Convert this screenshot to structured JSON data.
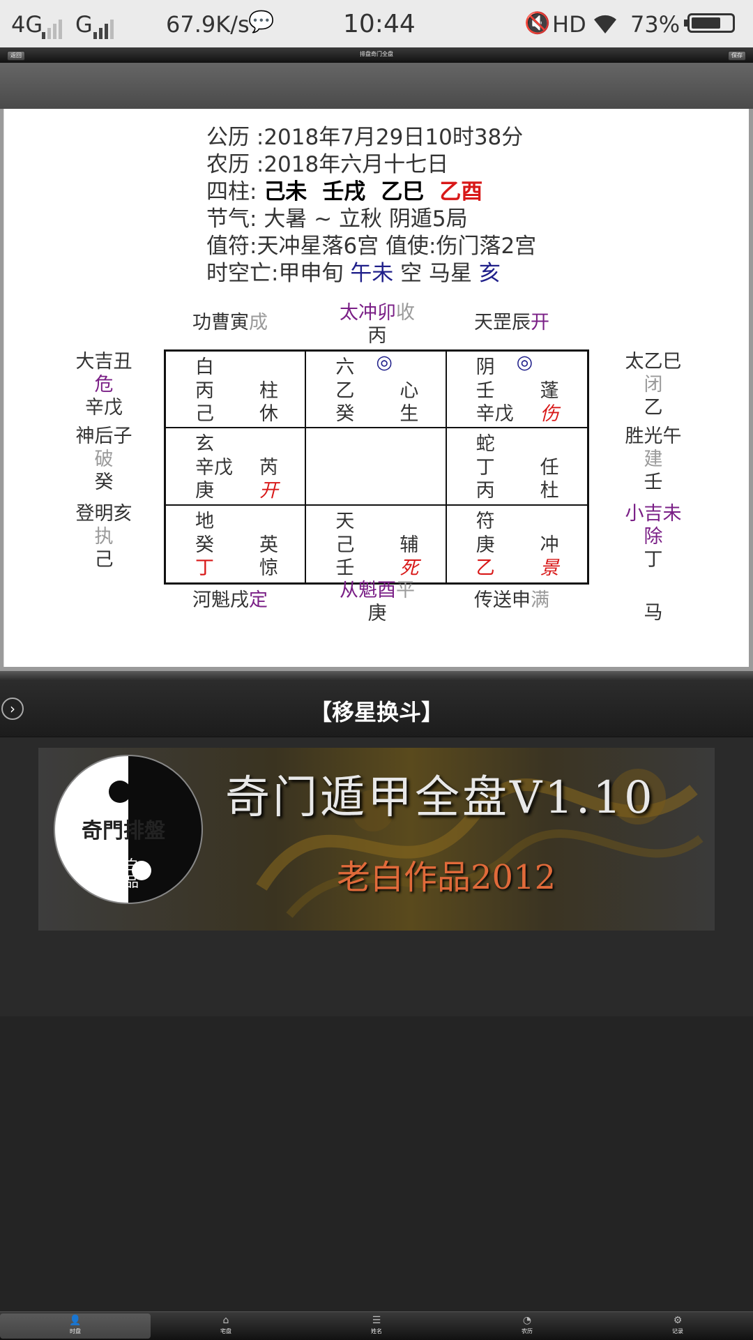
{
  "status_bar": {
    "network1": "4G",
    "network2": "G",
    "speed": "67.9K/s",
    "time": "10:44",
    "hd": "HD",
    "battery": "73%",
    "battery_level": 0.73
  },
  "top_bar": {
    "left_button": "返回",
    "title": "排盘奇门全盘",
    "right_button": "保存"
  },
  "chart": {
    "info": {
      "gregorian_label": "公历 :",
      "gregorian_value": "2018年7月29日10时38分",
      "lunar_label": "农历 :",
      "lunar_value": "2018年六月十七日",
      "pillars_label": "四柱: ",
      "pillar1": "己未",
      "pillar2": "壬戌",
      "pillar3": "乙巳",
      "pillar4": "乙酉",
      "term_label": "节气: ",
      "term_value": "大暑 ~ 立秋 阴遁5局",
      "duty_value": "值符:天冲星落6宫 值使:伤门落2宫",
      "void_prefix": "时空亡:甲申旬 ",
      "void_value": "午未",
      "void_mid": " 空 马星 ",
      "horse_value": "亥"
    },
    "top": {
      "left_name": "功曹寅",
      "left_status": "成",
      "mid_name": "太冲卯",
      "mid_status": "收",
      "mid_stem": "丙",
      "right_name": "天罡辰",
      "right_status": "开"
    },
    "bottom": {
      "left_name": "河魁戌",
      "left_status": "定",
      "mid_name": "从魁酉",
      "mid_status": "平",
      "mid_stem": "庚",
      "right_name": "传送申",
      "right_status": "满",
      "horse": "马"
    },
    "left": [
      {
        "name": "大吉丑",
        "status": "危",
        "stem": "辛戊"
      },
      {
        "name": "神后子",
        "status": "破",
        "stem": "癸"
      },
      {
        "name": "登明亥",
        "status": "执",
        "stem": "己"
      }
    ],
    "right": [
      {
        "name": "太乙巳",
        "status": "闭",
        "stem": "乙"
      },
      {
        "name": "胜光午",
        "status": "建",
        "stem": "壬"
      },
      {
        "name": "小吉未",
        "status": "除",
        "stem": "丁"
      }
    ],
    "palaces": [
      {
        "god": "白",
        "ring": "",
        "stem_top": "丙",
        "star": "柱",
        "stem_bottom": "己",
        "door": "休"
      },
      {
        "god": "六",
        "ring": "◎",
        "stem_top": "乙",
        "star": "心",
        "stem_bottom": "癸",
        "door": "生"
      },
      {
        "god": "阴",
        "ring": "◎",
        "stem_top": "壬",
        "star": "蓬",
        "stem_bottom": "辛戊",
        "door": "伤"
      },
      {
        "god": "玄",
        "ring": "",
        "stem_top": "辛戊",
        "star": "芮",
        "stem_bottom": "庚",
        "door": "开"
      },
      {
        "god": "",
        "ring": "",
        "stem_top": "",
        "star": "",
        "stem_bottom": "",
        "door": ""
      },
      {
        "god": "蛇",
        "ring": "",
        "stem_top": "丁",
        "star": "任",
        "stem_bottom": "丙",
        "door": "杜"
      },
      {
        "god": "地",
        "ring": "",
        "stem_top": "癸",
        "star": "英",
        "stem_bottom": "丁",
        "door": "惊"
      },
      {
        "god": "天",
        "ring": "",
        "stem_top": "己",
        "star": "辅",
        "stem_bottom": "壬",
        "door": "死"
      },
      {
        "god": "符",
        "ring": "",
        "stem_top": "庚",
        "star": "冲",
        "stem_bottom": "乙",
        "door": "景"
      }
    ]
  },
  "section_title": "【移星换斗】",
  "banner": {
    "logo_text": "奇門排盤",
    "logo_sub1": "老白",
    "logo_sub2": "作品",
    "title": "奇门遁甲全盘V1.10",
    "subtitle": "老白作品2012"
  },
  "bottom_nav": [
    {
      "label": "时盘",
      "icon": "person-icon"
    },
    {
      "label": "宅盘",
      "icon": "house-icon"
    },
    {
      "label": "姓名",
      "icon": "list-icon"
    },
    {
      "label": "农历",
      "icon": "calendar-icon"
    },
    {
      "label": "记录",
      "icon": "gear-icon"
    }
  ],
  "colors": {
    "red": "#d81818",
    "purple": "#7a1f86",
    "navy": "#1f1f8a",
    "gray": "#9a9a9a"
  }
}
